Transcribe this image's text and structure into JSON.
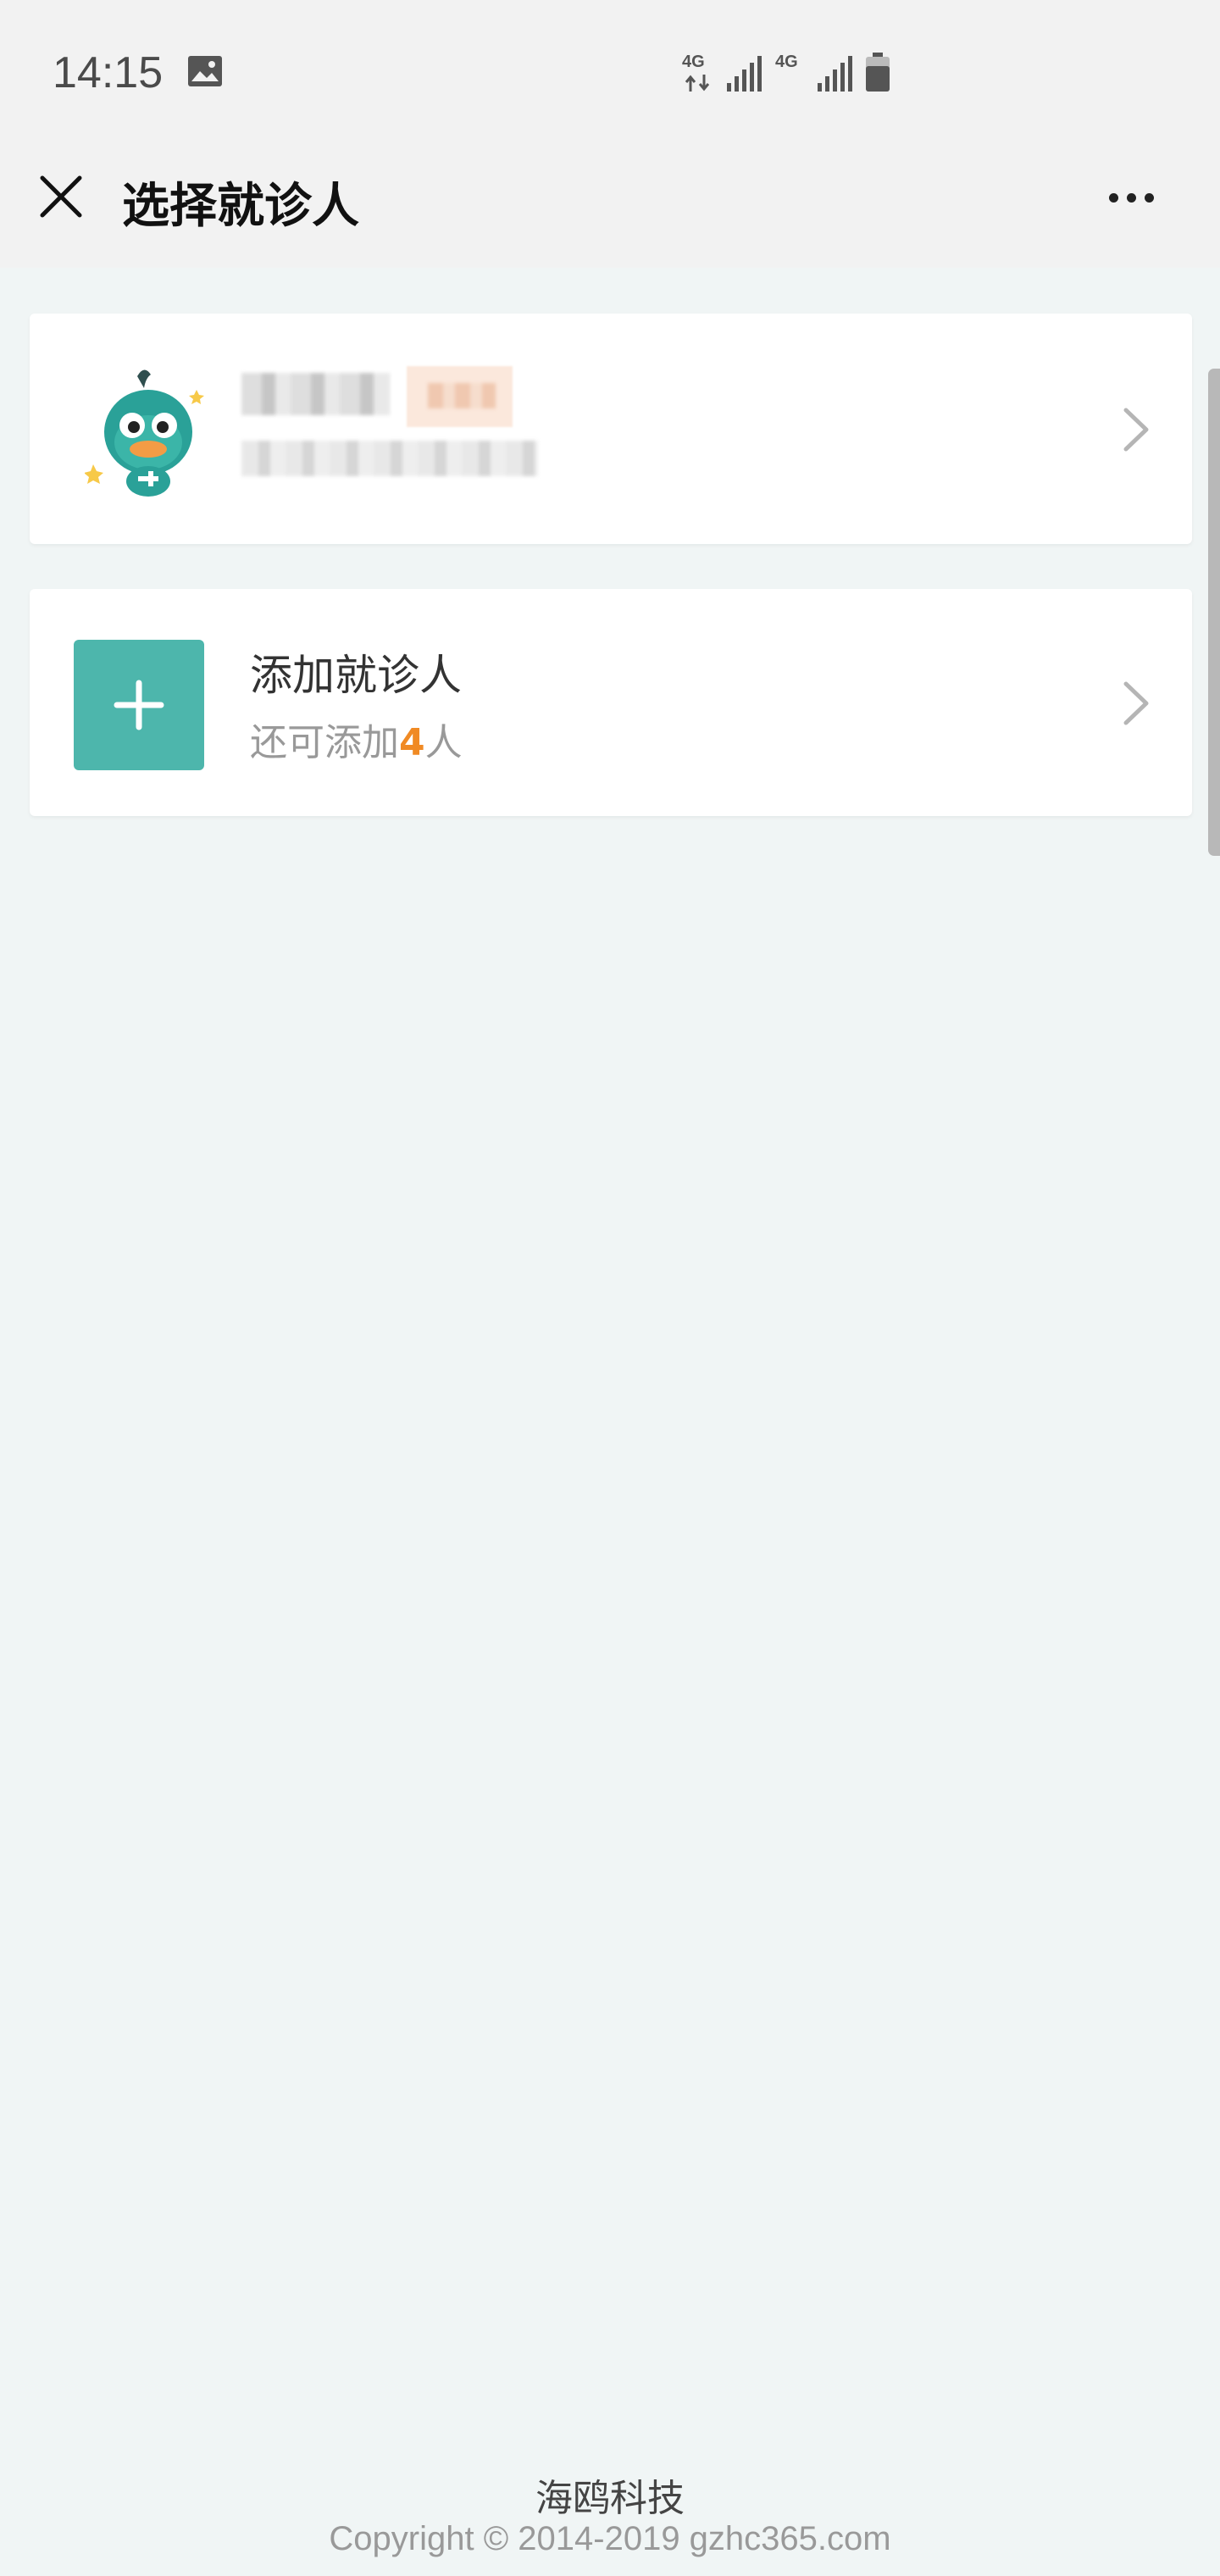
{
  "status_bar": {
    "time": "14:15",
    "network_1": "4G",
    "network_2": "4G",
    "icons": [
      "image-icon",
      "data-transfer-icon",
      "signal-icon",
      "battery-icon"
    ]
  },
  "header": {
    "title": "选择就诊人",
    "close_icon": "close-icon",
    "more_icon": "more-icon"
  },
  "patient_card": {
    "avatar_icon": "duck-mascot-avatar",
    "name_blurred": true,
    "id_blurred": true
  },
  "add_card": {
    "title": "添加就诊人",
    "sub_prefix": "还可添加",
    "remaining": "4",
    "sub_suffix": "人"
  },
  "footer": {
    "company": "海鸥科技",
    "copyright": "Copyright © 2014-2019 gzhc365.com"
  },
  "colors": {
    "accent": "#4db6ac",
    "highlight": "#f08a24",
    "background": "#f0f5f5"
  }
}
